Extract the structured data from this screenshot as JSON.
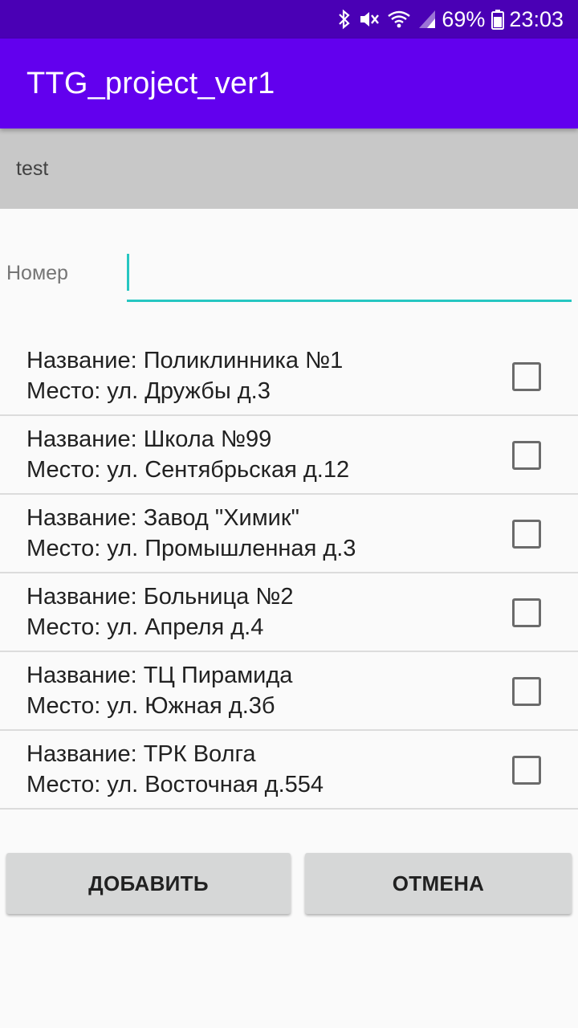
{
  "status_bar": {
    "battery": "69%",
    "time": "23:03",
    "icons": [
      "bluetooth-icon",
      "mute-icon",
      "wifi-icon",
      "signal-icon",
      "battery-icon"
    ]
  },
  "app_bar": {
    "title": "TTG_project_ver1"
  },
  "subtitle": {
    "text": "test"
  },
  "number_field": {
    "label": "Номер",
    "value": ""
  },
  "list": {
    "items": [
      {
        "name": "Название: Поликлинника №1",
        "place": "Место: ул. Дружбы д.3",
        "checked": false
      },
      {
        "name": "Название: Школа №99",
        "place": "Место: ул. Сентябрьская д.12",
        "checked": false
      },
      {
        "name": "Название: Завод \"Химик\"",
        "place": "Место: ул. Промышленная д.3",
        "checked": false
      },
      {
        "name": "Название: Больница №2",
        "place": "Место: ул. Апреля д.4",
        "checked": false
      },
      {
        "name": "Название: ТЦ Пирамида",
        "place": "Место: ул. Южная д.3б",
        "checked": false
      },
      {
        "name": "Название: ТРК Волга",
        "place": "Место: ул. Восточная д.554",
        "checked": false
      }
    ]
  },
  "buttons": {
    "add": "ДОБАВИТЬ",
    "cancel": "ОТМЕНА"
  },
  "colors": {
    "status_bar": "#4a00b5",
    "app_bar": "#6200ee",
    "accent": "#26c6c1",
    "button_bg": "#d6d7d7"
  }
}
